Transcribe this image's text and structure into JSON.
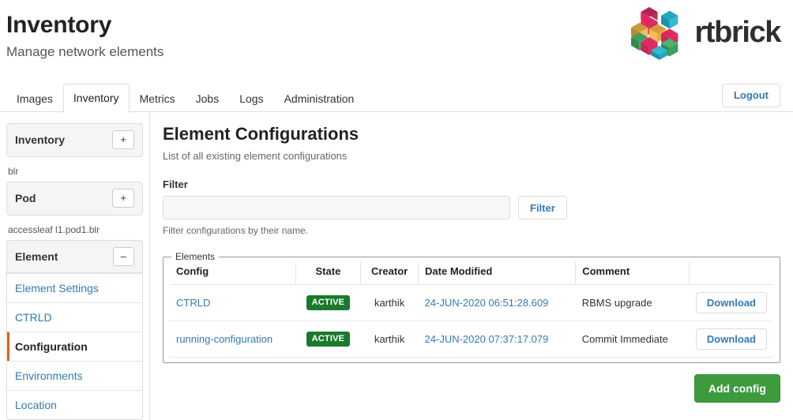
{
  "header": {
    "title": "Inventory",
    "subtitle": "Manage network elements",
    "brand_name": "rtbrick",
    "brand_icon": "rtbrick-cubes-logo"
  },
  "tabs": {
    "items": [
      {
        "label": "Images",
        "active": false
      },
      {
        "label": "Inventory",
        "active": true
      },
      {
        "label": "Metrics",
        "active": false
      },
      {
        "label": "Jobs",
        "active": false
      },
      {
        "label": "Logs",
        "active": false
      },
      {
        "label": "Administration",
        "active": false
      }
    ],
    "logout_label": "Logout"
  },
  "sidebar": {
    "inventory_panel": {
      "title": "Inventory",
      "toggle": "+"
    },
    "pod_group_label": "blr",
    "pod_panel": {
      "title": "Pod",
      "toggle": "+"
    },
    "element_group_label": "accessleaf l1.pod1.blr",
    "element_panel": {
      "title": "Element",
      "toggle": "–"
    },
    "nav_items": [
      {
        "label": "Element Settings",
        "active": false
      },
      {
        "label": "CTRLD",
        "active": false
      },
      {
        "label": "Configuration",
        "active": true
      },
      {
        "label": "Environments",
        "active": false
      },
      {
        "label": "Location",
        "active": false
      }
    ]
  },
  "main": {
    "title": "Element Configurations",
    "subtitle": "List of all existing element configurations",
    "filter": {
      "label": "Filter",
      "value": "",
      "placeholder": "",
      "button_label": "Filter",
      "help": "Filter configurations by their name."
    },
    "fieldset_legend": "Elements",
    "table": {
      "columns": [
        "Config",
        "State",
        "Creator",
        "Date Modified",
        "Comment",
        ""
      ],
      "rows": [
        {
          "config": "CTRLD",
          "state": "ACTIVE",
          "creator": "karthik",
          "date_modified": "24-JUN-2020 06:51:28.609",
          "comment": "RBMS upgrade",
          "action_label": "Download"
        },
        {
          "config": "running-configuration",
          "state": "ACTIVE",
          "creator": "karthik",
          "date_modified": "24-JUN-2020 07:37:17.079",
          "comment": "Commit Immediate",
          "action_label": "Download"
        }
      ]
    },
    "add_button_label": "Add config"
  },
  "colors": {
    "link": "#337ab7",
    "active_badge": "#1a7a2c",
    "add_button": "#3d9a3d",
    "active_marker": "#e8601c"
  }
}
